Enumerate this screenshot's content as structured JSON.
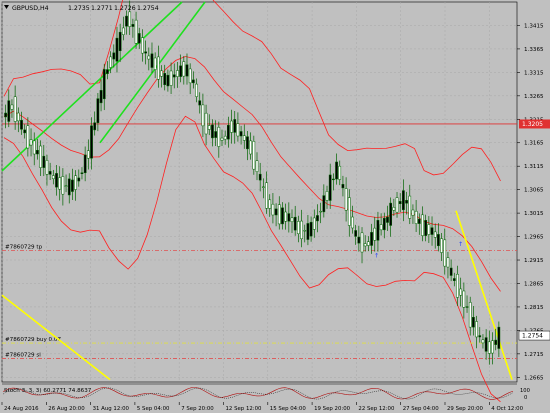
{
  "window": {
    "symbol_label": "GBPUSD,H4",
    "ohlc": [
      "1.2735",
      "1.2771",
      "1.2726",
      "1.2754"
    ],
    "current_price_label": "1.2754",
    "level_price_label": "1.3205",
    "oscillator_label": "Stoch 3, 3, 3) 60.2771 74.8637",
    "oscillator_scale_top": "100",
    "oscillator_scale_bottom": "0"
  },
  "orders": [
    {
      "label": "#7860729 tp",
      "price": 1.2935
    },
    {
      "label": "#7860729 buy 0.07",
      "price": 1.2738
    },
    {
      "label": "#7860729 sl",
      "price": 1.2705
    }
  ],
  "colors": {
    "background": "#c0c0c0",
    "grid": "#a8a8a8",
    "candle": "#006400",
    "bands": "#ff2020",
    "trend_green": "#1fe01f",
    "trend_yellow": "#ffff00",
    "level_line": "#e03030",
    "axis_text": "#000000"
  },
  "chart_data": {
    "type": "candlestick",
    "symbol": "GBPUSD,H4",
    "ohlc_header": {
      "open": 1.2735,
      "high": 1.2771,
      "low": 1.2726,
      "close": 1.2754
    },
    "x_tick_labels": [
      "24 Aug 2016",
      "26 Aug 20:00",
      "31 Aug 12:00",
      "5 Sep 04:00",
      "7 Sep 20:00",
      "12 Sep 12:00",
      "15 Sep 04:00",
      "19 Sep 20:00",
      "22 Sep 12:00",
      "27 Sep 04:00",
      "29 Sep 20:00",
      "4 Oct 12:00"
    ],
    "y_tick_labels": [
      "1.3415",
      "1.3365",
      "1.3315",
      "1.3265",
      "1.3215",
      "1.3165",
      "1.3115",
      "1.3065",
      "1.3015",
      "1.2965",
      "1.2915",
      "1.2865",
      "1.2815",
      "1.2765",
      "1.2715",
      "1.2665"
    ],
    "ylim": [
      1.2655,
      1.3465
    ],
    "horizontal_level": 1.3205,
    "current_price": 1.2754,
    "close_path": [
      1.322,
      1.3245,
      1.3195,
      1.316,
      1.313,
      1.3095,
      1.3075,
      1.307,
      1.309,
      1.315,
      1.325,
      1.333,
      1.337,
      1.3435,
      1.3395,
      1.335,
      1.333,
      1.3295,
      1.331,
      1.3325,
      1.329,
      1.321,
      1.3185,
      1.317,
      1.3205,
      1.318,
      1.315,
      1.308,
      1.3025,
      1.301,
      1.3005,
      1.298,
      1.2975,
      1.301,
      1.306,
      1.3115,
      1.303,
      1.296,
      1.2945,
      1.2975,
      1.2995,
      1.303,
      1.3045,
      1.301,
      1.2985,
      1.2975,
      1.294,
      1.288,
      1.284,
      1.279,
      1.2745,
      1.2725,
      1.2754
    ],
    "stochastic": {
      "k": 60.2771,
      "d": 74.8637
    }
  }
}
